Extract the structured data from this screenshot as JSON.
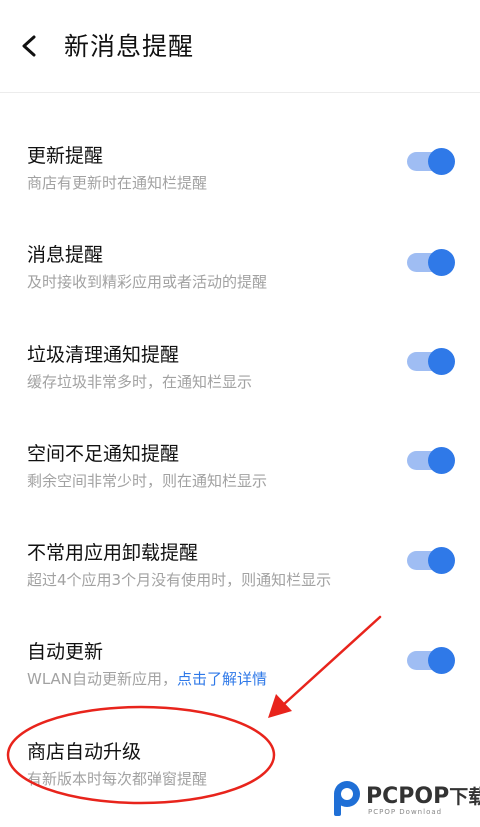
{
  "header": {
    "back_icon": "chevron-left-icon",
    "title": "新消息提醒"
  },
  "settings": [
    {
      "title": "更新提醒",
      "subtitle": "商店有更新时在通知栏提醒",
      "enabled": true
    },
    {
      "title": "消息提醒",
      "subtitle": "及时接收到精彩应用或者活动的提醒",
      "enabled": true
    },
    {
      "title": "垃圾清理通知提醒",
      "subtitle": "缓存垃圾非常多时，在通知栏显示",
      "enabled": true
    },
    {
      "title": "空间不足通知提醒",
      "subtitle": "剩余空间非常少时，则在通知栏显示",
      "enabled": true
    },
    {
      "title": "不常用应用卸载提醒",
      "subtitle": "超过4个应用3个月没有使用时，则通知栏显示",
      "enabled": true
    },
    {
      "title": "自动更新",
      "subtitle": "WLAN自动更新应用，",
      "link": "点击了解详情",
      "enabled": true
    },
    {
      "title": "商店自动升级",
      "subtitle": "有新版本时每次都弹窗提醒"
    }
  ],
  "watermark": {
    "brand": "PCPOP",
    "brand_suffix": "下载",
    "sub": "PCPOP Download"
  },
  "colors": {
    "accent": "#2f79e8",
    "toggle_track": "#9fbdf3",
    "annotation": "#e8241c"
  }
}
